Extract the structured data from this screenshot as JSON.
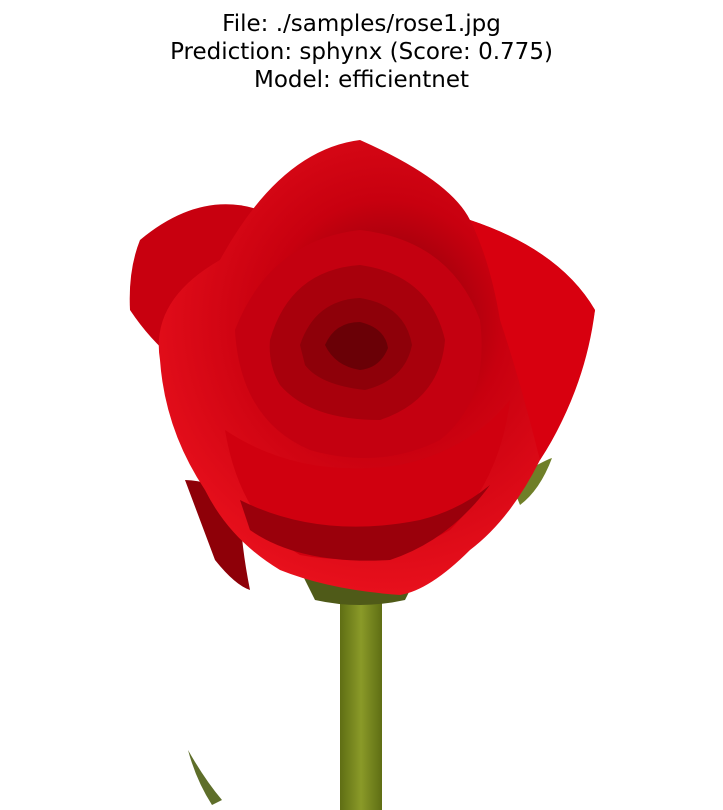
{
  "title": {
    "line1": "File: ./samples/rose1.jpg",
    "line2": "Prediction: sphynx (Score: 0.775)",
    "line3": "Model: efficientnet"
  },
  "image": {
    "subject": "red-rose",
    "colors": {
      "petal_dark": "#9e0009",
      "petal_mid": "#c8000f",
      "petal_light": "#e8101c",
      "stem": "#7a8a1c",
      "leaf": "#5e6e2a",
      "background": "#ffffff"
    }
  }
}
